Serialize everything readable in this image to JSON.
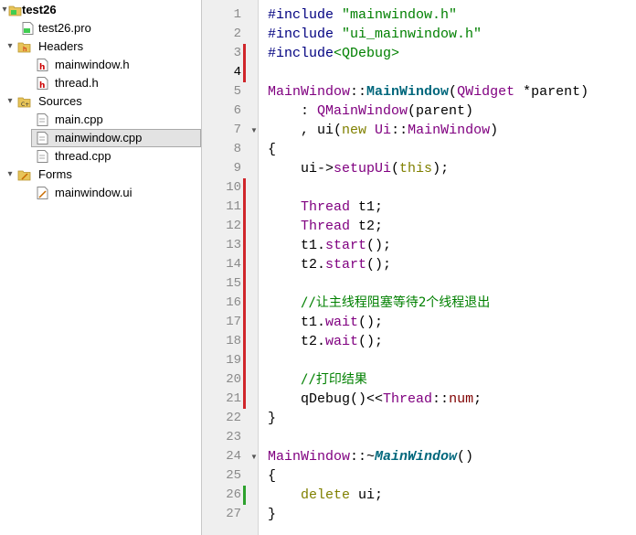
{
  "tree": {
    "project": "test26",
    "pro_file": "test26.pro",
    "headers_label": "Headers",
    "headers": [
      "mainwindow.h",
      "thread.h"
    ],
    "sources_label": "Sources",
    "sources": [
      "main.cpp",
      "mainwindow.cpp",
      "thread.cpp"
    ],
    "forms_label": "Forms",
    "forms": [
      "mainwindow.ui"
    ],
    "selected_file": "mainwindow.cpp"
  },
  "editor": {
    "line_numbers": [
      "1",
      "2",
      "3",
      "4",
      "5",
      "6",
      "7",
      "8",
      "9",
      "10",
      "11",
      "12",
      "13",
      "14",
      "15",
      "16",
      "17",
      "18",
      "19",
      "20",
      "21",
      "22",
      "23",
      "24",
      "25",
      "26",
      "27"
    ],
    "current_line": 4,
    "changed_lines_red": [
      3,
      4,
      10,
      11,
      12,
      13,
      14,
      15,
      16,
      17,
      18,
      19,
      20,
      21
    ],
    "changed_lines_green": [
      26
    ],
    "fold_lines": [
      7,
      24
    ],
    "code": {
      "l1a": "#include ",
      "l1b": "\"mainwindow.h\"",
      "l2a": "#include ",
      "l2b": "\"ui_mainwindow.h\"",
      "l3a": "#include",
      "l3b": "<QDebug>",
      "l5a": "MainWindow",
      "l5b": "::",
      "l5c": "MainWindow",
      "l5d": "(",
      "l5e": "QWidget",
      "l5f": " *parent)",
      "l6a": "    : ",
      "l6b": "QMainWindow",
      "l6c": "(parent)",
      "l7a": "    , ui(",
      "l7b": "new",
      "l7c": " ",
      "l7d": "Ui",
      "l7e": "::",
      "l7f": "MainWindow",
      "l7g": ")",
      "l8": "{",
      "l9a": "    ui->",
      "l9b": "setupUi",
      "l9c": "(",
      "l9d": "this",
      "l9e": ");",
      "l11a": "    ",
      "l11b": "Thread",
      "l11c": " t1;",
      "l12a": "    ",
      "l12b": "Thread",
      "l12c": " t2;",
      "l13a": "    t1.",
      "l13b": "start",
      "l13c": "();",
      "l14a": "    t2.",
      "l14b": "start",
      "l14c": "();",
      "l16a": "    ",
      "l16b": "//让主线程阻塞等待2个线程退出",
      "l17a": "    t1.",
      "l17b": "wait",
      "l17c": "();",
      "l18a": "    t2.",
      "l18b": "wait",
      "l18c": "();",
      "l20a": "    ",
      "l20b": "//打印结果",
      "l21a": "    qDebug()<<",
      "l21b": "Thread",
      "l21c": "::",
      "l21d": "num",
      "l21e": ";",
      "l22": "}",
      "l24a": "MainWindow",
      "l24b": "::~",
      "l24c": "MainWindow",
      "l24d": "()",
      "l25": "{",
      "l26a": "    ",
      "l26b": "delete",
      "l26c": " ui;",
      "l27": "}"
    }
  },
  "icons": {
    "project": "qt-project-folder-icon",
    "pro": "qt-pro-file-icon",
    "header_folder": "header-folder-icon",
    "header_file": "header-file-icon",
    "source_folder": "source-folder-icon",
    "source_file": "source-file-icon",
    "form_folder": "form-folder-icon",
    "form_file": "form-file-icon"
  },
  "colors": {
    "change_red": "#d0262b",
    "change_green": "#2da12d",
    "selection": "#e3e3e3"
  }
}
